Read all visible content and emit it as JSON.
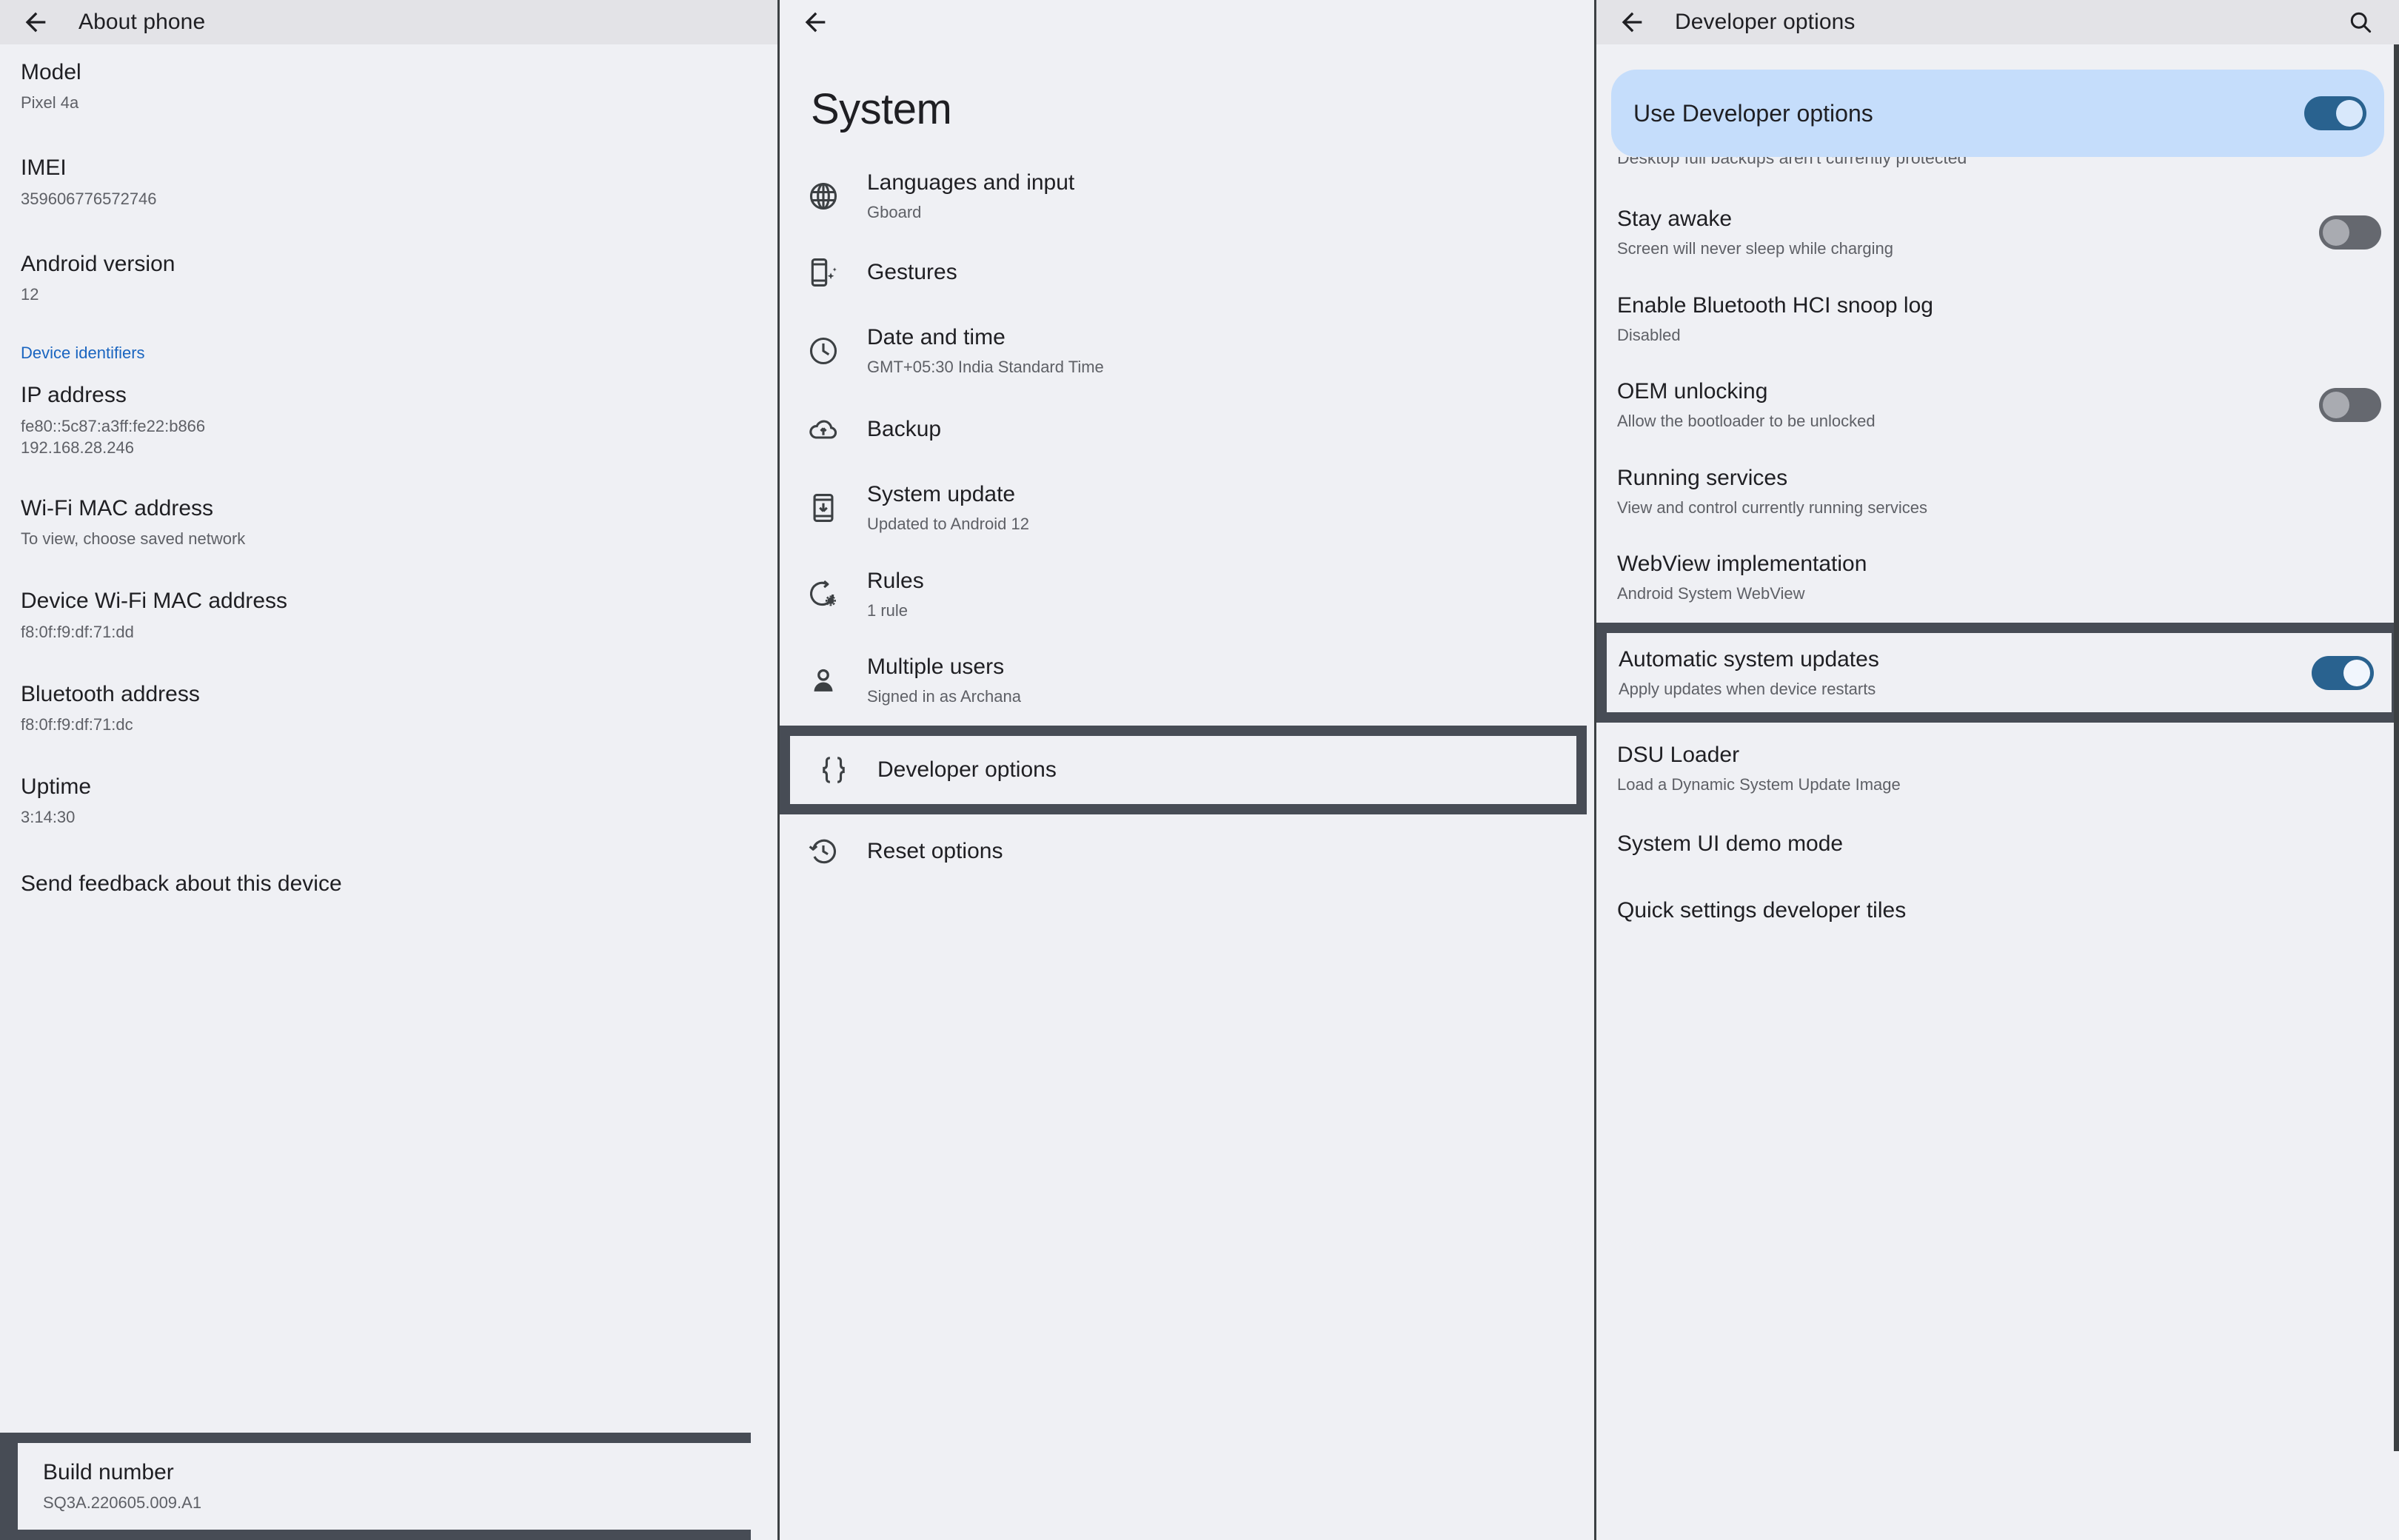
{
  "panel_about": {
    "appbar": {
      "title": "About phone",
      "back_icon": "arrow-back-icon"
    },
    "items": [
      {
        "title": "Model",
        "sub": "Pixel 4a"
      },
      {
        "title": "IMEI",
        "sub": "359606776572746"
      },
      {
        "title": "Android version",
        "sub": "12"
      }
    ],
    "section_link": "Device identifiers",
    "items2": [
      {
        "title": "IP address",
        "sub": "fe80::5c87:a3ff:fe22:b866\n192.168.28.246"
      },
      {
        "title": "Wi-Fi MAC address",
        "sub": "To view, choose saved network"
      },
      {
        "title": "Device Wi-Fi MAC address",
        "sub": "f8:0f:f9:df:71:dd"
      },
      {
        "title": "Bluetooth address",
        "sub": "f8:0f:f9:df:71:dc"
      },
      {
        "title": "Uptime",
        "sub": "3:14:30"
      },
      {
        "title": "Send feedback about this device",
        "sub": ""
      }
    ],
    "highlighted": {
      "title": "Build number",
      "sub": "SQ3A.220605.009.A1"
    }
  },
  "panel_system": {
    "appbar": {
      "back_icon": "arrow-back-icon"
    },
    "page_title": "System",
    "rows": [
      {
        "icon": "globe-icon",
        "title": "Languages and input",
        "sub": "Gboard"
      },
      {
        "icon": "gestures-phone-icon",
        "title": "Gestures",
        "sub": ""
      },
      {
        "icon": "clock-icon",
        "title": "Date and time",
        "sub": "GMT+05:30 India Standard Time"
      },
      {
        "icon": "cloud-upload-icon",
        "title": "Backup",
        "sub": ""
      },
      {
        "icon": "system-update-icon",
        "title": "System update",
        "sub": "Updated to Android 12"
      },
      {
        "icon": "rules-gear-icon",
        "title": "Rules",
        "sub": "1 rule"
      },
      {
        "icon": "person-icon",
        "title": "Multiple users",
        "sub": "Signed in as Archana"
      }
    ],
    "highlighted_row": {
      "icon": "braces-icon",
      "title": "Developer options",
      "sub": ""
    },
    "rows_after": [
      {
        "icon": "history-icon",
        "title": "Reset options",
        "sub": ""
      }
    ]
  },
  "panel_developer": {
    "appbar": {
      "title": "Developer options",
      "back_icon": "arrow-back-icon",
      "search_icon": "search-icon"
    },
    "master_toggle": {
      "label": "Use Developer options",
      "state": "on"
    },
    "clipped_banner": "Desktop full backups aren't currently protected",
    "prefs": [
      {
        "title": "Stay awake",
        "sub": "Screen will never sleep while charging",
        "toggle": "off"
      },
      {
        "title": "Enable Bluetooth HCI snoop log",
        "sub": "Disabled",
        "toggle": "none"
      },
      {
        "title": "OEM unlocking",
        "sub": "Allow the bootloader to be unlocked",
        "toggle": "off"
      },
      {
        "title": "Running services",
        "sub": "View and control currently running services",
        "toggle": "none"
      },
      {
        "title": "WebView implementation",
        "sub": "Android System WebView",
        "toggle": "none"
      }
    ],
    "highlighted_pref": {
      "title": "Automatic system updates",
      "sub": "Apply updates when device restarts",
      "toggle": "on"
    },
    "prefs_after": [
      {
        "title": "DSU Loader",
        "sub": "Load a Dynamic System Update Image",
        "toggle": "none"
      },
      {
        "title": "System UI demo mode",
        "sub": "",
        "toggle": "none"
      },
      {
        "title": "Quick settings developer tiles",
        "sub": "",
        "toggle": "none"
      }
    ]
  },
  "colors": {
    "background": "#eff0f4",
    "appbar": "#e3e3e7",
    "highlight_border": "#474c55",
    "accent_blue": "#29628f",
    "card_blue": "#c5ddfb",
    "link_blue": "#1a65c0",
    "text_primary": "#1f1f23",
    "text_secondary": "#5e6066",
    "toggle_off": "#65686f"
  }
}
